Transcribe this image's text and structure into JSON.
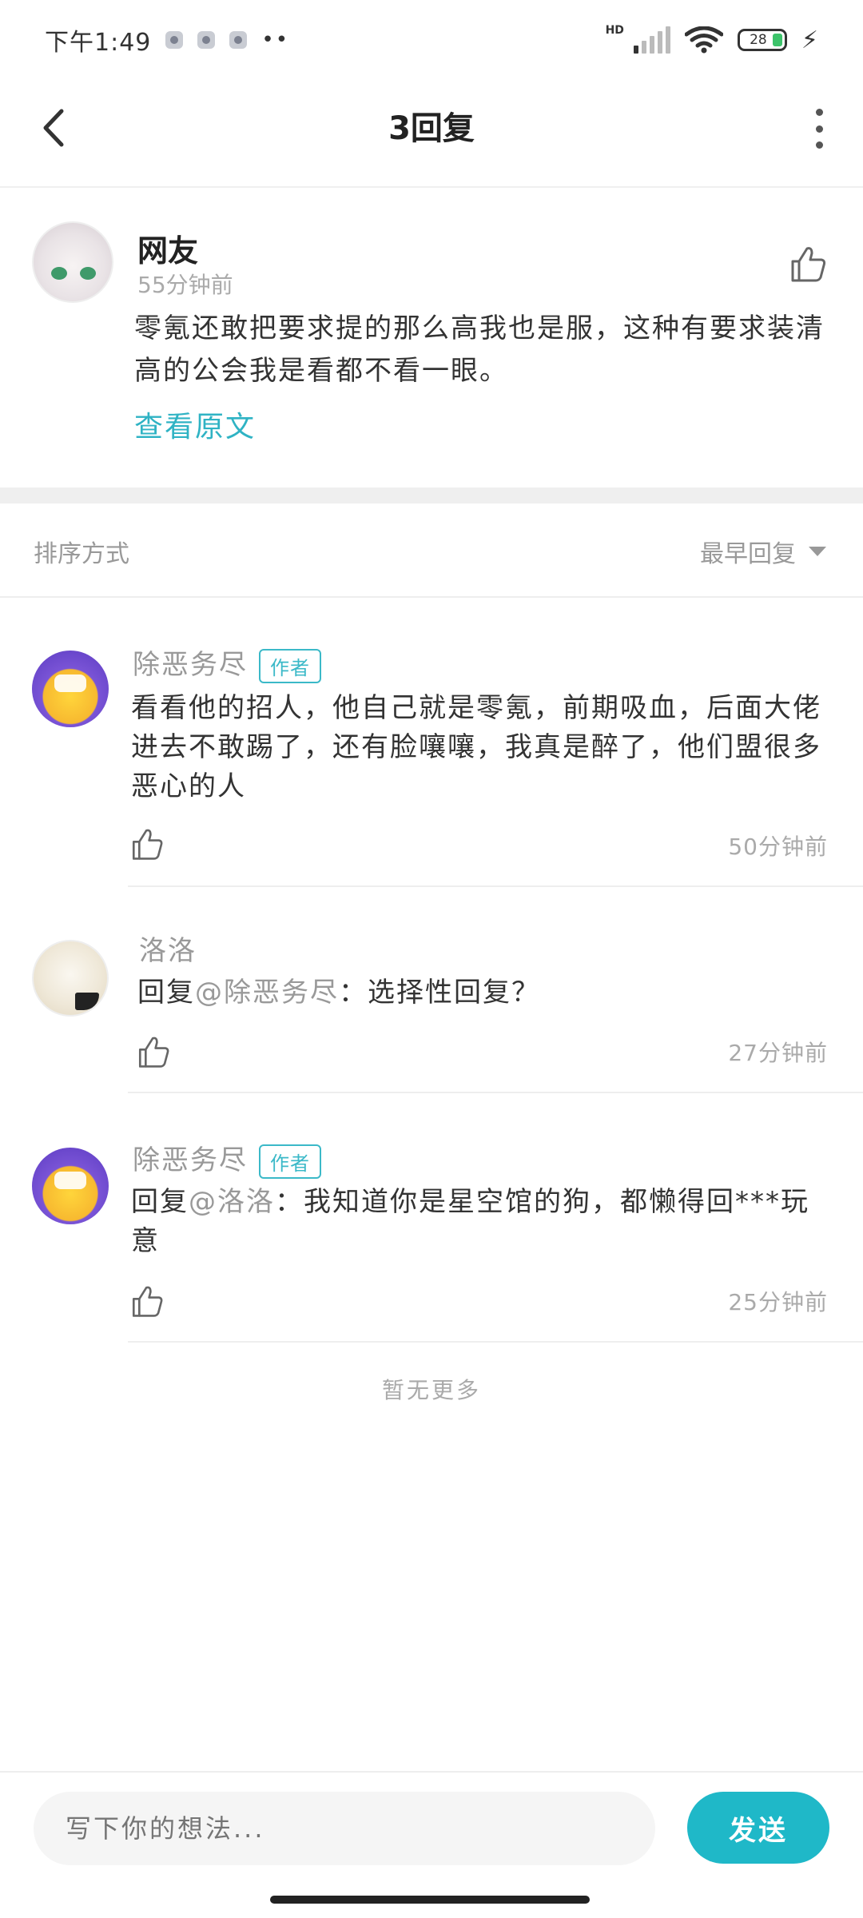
{
  "status_bar": {
    "time": "下午1:49",
    "dots": "••",
    "hd": "HD",
    "battery": "28"
  },
  "nav": {
    "title": "3回复"
  },
  "post": {
    "author": "网友",
    "time": "55分钟前",
    "text": "零氪还敢把要求提的那么高我也是服，这种有要求装清高的公会我是看都不看一眼。",
    "view_original": "查看原文"
  },
  "sort": {
    "label": "排序方式",
    "selected": "最早回复"
  },
  "comments": [
    {
      "name": "除恶务尽",
      "badge": "作者",
      "text": "看看他的招人，他自己就是零氪，前期吸血，后面大佬进去不敢踢了，还有脸嚷嚷，我真是醉了，他们盟很多恶心的人",
      "time": "50分钟前"
    },
    {
      "name": "洛洛",
      "reply_prefix": "回复",
      "mention": "@除恶务尽",
      "text": "：选择性回复？",
      "time": "27分钟前"
    },
    {
      "name": "除恶务尽",
      "badge": "作者",
      "reply_prefix": "回复",
      "mention": "@洛洛",
      "text": "：我知道你是星空馆的狗，都懒得回***玩意",
      "time": "25分钟前"
    }
  ],
  "no_more": "暂无更多",
  "bottom": {
    "placeholder": "写下你的想法...",
    "send": "发送"
  },
  "colors": {
    "accent": "#1fb8c8",
    "link": "#2fb3c4"
  }
}
